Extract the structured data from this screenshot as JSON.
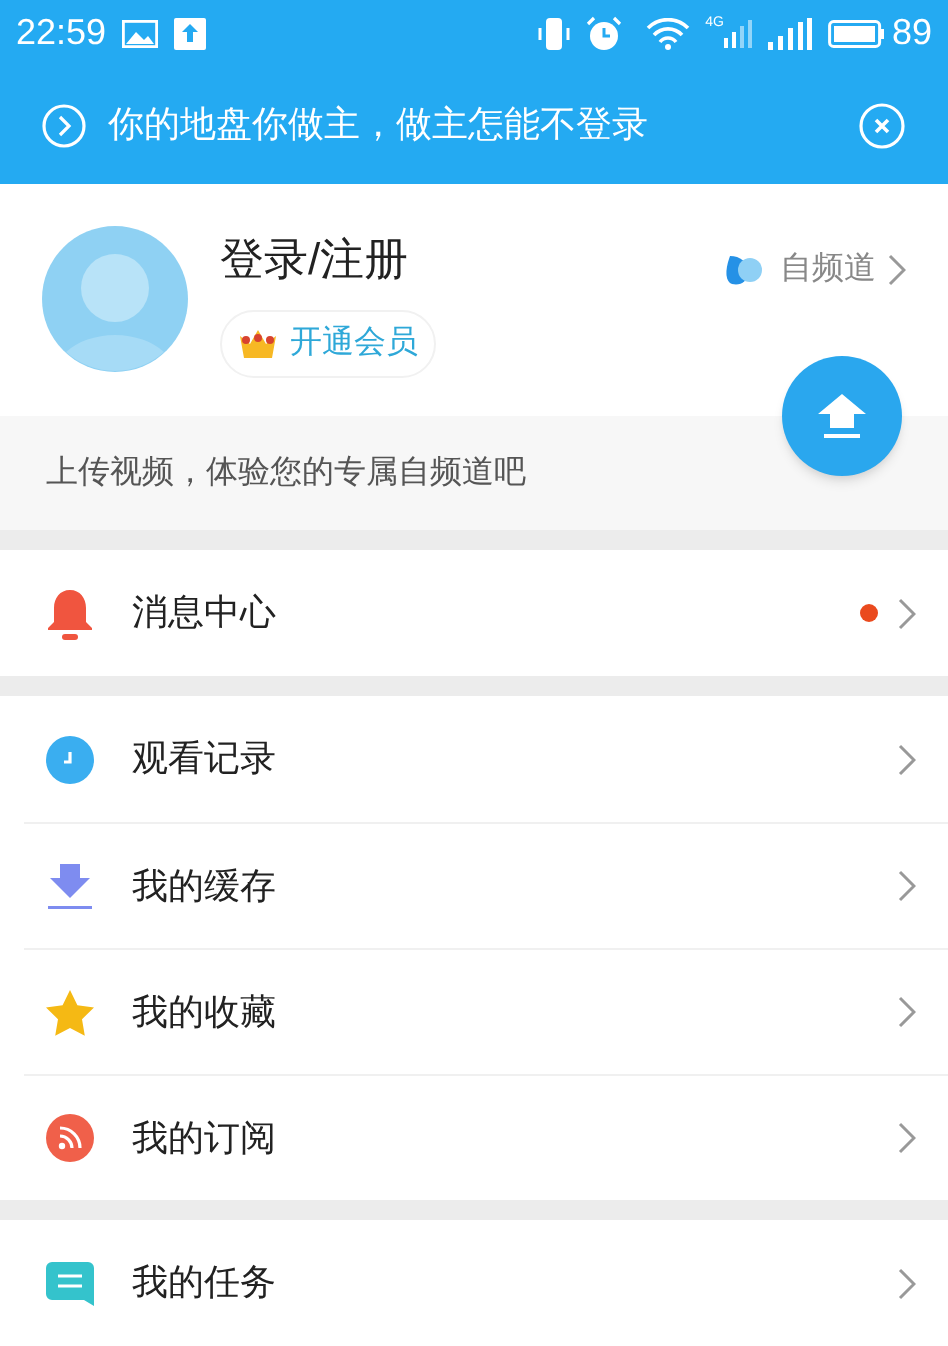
{
  "status_bar": {
    "time": "22:59",
    "network": "4G",
    "battery": "89"
  },
  "banner": {
    "text": "你的地盘你做主，做主怎能不登录"
  },
  "profile": {
    "title": "登录/注册",
    "vip_label": "开通会员",
    "channel_link": "自频道",
    "upload_hint": "上传视频，体验您的专属自频道吧"
  },
  "menu_groups": [
    {
      "items": [
        {
          "kind": "bell",
          "label": "消息中心",
          "unread": true
        }
      ]
    },
    {
      "items": [
        {
          "kind": "clock",
          "label": "观看记录",
          "unread": false
        },
        {
          "kind": "download",
          "label": "我的缓存",
          "unread": false
        },
        {
          "kind": "star",
          "label": "我的收藏",
          "unread": false
        },
        {
          "kind": "rss",
          "label": "我的订阅",
          "unread": false
        }
      ]
    },
    {
      "items": [
        {
          "kind": "task",
          "label": "我的任务",
          "unread": false
        }
      ]
    }
  ]
}
